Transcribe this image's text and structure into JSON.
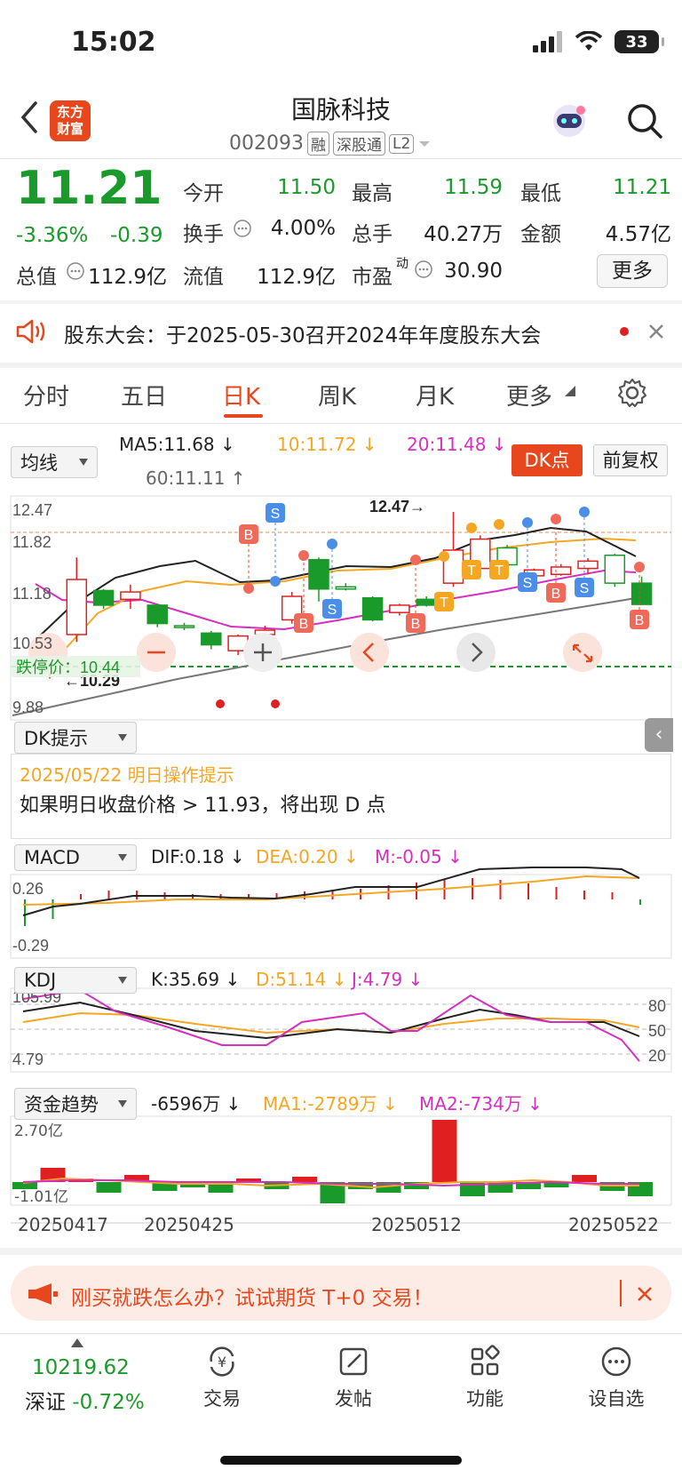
{
  "status": {
    "time": "15:02",
    "battery": "33"
  },
  "header": {
    "logo_line1": "东方",
    "logo_line2": "财富",
    "name": "国脉科技",
    "code": "002093",
    "tags": [
      "融",
      "深股通",
      "L2"
    ]
  },
  "quote": {
    "price": "11.21",
    "pct": "-3.36%",
    "change": "-0.39",
    "labels": {
      "open": "今开",
      "high": "最高",
      "low": "最低",
      "turnover": "换手",
      "volume": "总手",
      "amount": "金额",
      "mktcap": "总值",
      "float": "流值",
      "pe": "市盈",
      "pe_sup": "动"
    },
    "open": "11.50",
    "high": "11.59",
    "low": "11.21",
    "turnover": "4.00%",
    "volume": "40.27万",
    "amount": "4.57亿",
    "mktcap": "112.9亿",
    "float": "112.9亿",
    "pe": "30.90",
    "more": "更多"
  },
  "notice": {
    "text": "股东大会：于2025-05-30召开2024年年度股东大会"
  },
  "tabs": [
    "分时",
    "五日",
    "日K",
    "周K",
    "月K",
    "更多"
  ],
  "kline": {
    "selector": "均线",
    "ma5": "MA5:11.68",
    "ma10": "10:11.72",
    "ma20": "20:11.48",
    "ma60": "60:11.11",
    "dk_button": "DK点",
    "fq_button": "前复权",
    "y_labels": [
      "12.47",
      "11.82",
      "11.18",
      "10.53",
      "9.88"
    ],
    "high_marker": "12.47",
    "low_marker": "10.29",
    "limit_down": "跌停价：10.44",
    "dk_selector": "DK提示",
    "dk_date": "2025/05/22 明日操作提示",
    "dk_content": "如果明日收盘价格 > 11.93，将出现 D 点"
  },
  "macd": {
    "selector": "MACD",
    "dif": "DIF:0.18",
    "dea": "DEA:0.20",
    "m": "M:-0.05",
    "y_top": "0.26",
    "y_bottom": "-0.29"
  },
  "kdj": {
    "selector": "KDJ",
    "k": "K:35.69",
    "d": "D:51.14",
    "j": "J:4.79",
    "y_top": "105.99",
    "y_bottom": "4.79",
    "levels": [
      "80",
      "50",
      "20"
    ]
  },
  "fund": {
    "selector": "资金趋势",
    "value": "-6596万",
    "ma1": "MA1:-2789万",
    "ma2": "MA2:-734万",
    "y_top": "2.70亿",
    "y_bottom": "-1.01亿"
  },
  "dates": [
    "20250417",
    "20250425",
    "20250512",
    "20250522"
  ],
  "ad": {
    "text": "刚买就跌怎么办？试试期货 T+0 交易！"
  },
  "bottom": {
    "index_value": "10219.62",
    "index_name": "深证",
    "index_change": "-0.72%",
    "nav": [
      "交易",
      "发帖",
      "功能",
      "设自选"
    ]
  },
  "chart_data": {
    "type": "candlestick",
    "y_range": [
      9.88,
      12.47
    ],
    "candles": [
      {
        "o": 10.3,
        "c": 10.75,
        "h": 10.8,
        "l": 10.2
      },
      {
        "o": 10.8,
        "c": 11.55,
        "h": 11.85,
        "l": 10.7
      },
      {
        "o": 11.4,
        "c": 11.2,
        "h": 11.42,
        "l": 11.15
      },
      {
        "o": 11.28,
        "c": 11.38,
        "h": 11.48,
        "l": 11.15
      },
      {
        "o": 11.2,
        "c": 10.95,
        "h": 11.22,
        "l": 10.9
      },
      {
        "o": 10.92,
        "c": 10.9,
        "h": 10.96,
        "l": 10.86
      },
      {
        "o": 10.82,
        "c": 10.66,
        "h": 10.85,
        "l": 10.6
      },
      {
        "o": 10.58,
        "c": 10.78,
        "h": 10.8,
        "l": 10.52
      },
      {
        "o": 10.8,
        "c": 10.86,
        "h": 10.92,
        "l": 10.7
      },
      {
        "o": 11.0,
        "c": 11.32,
        "h": 11.38,
        "l": 10.95
      },
      {
        "o": 11.82,
        "c": 11.42,
        "h": 11.85,
        "l": 11.25
      },
      {
        "o": 11.45,
        "c": 11.42,
        "h": 11.5,
        "l": 11.4
      },
      {
        "o": 11.3,
        "c": 11.0,
        "h": 11.32,
        "l": 10.98
      },
      {
        "o": 11.1,
        "c": 11.2,
        "h": 11.22,
        "l": 11.06
      },
      {
        "o": 11.28,
        "c": 11.2,
        "h": 11.32,
        "l": 11.18
      },
      {
        "o": 11.5,
        "c": 11.95,
        "h": 12.47,
        "l": 11.45
      },
      {
        "o": 11.7,
        "c": 12.1,
        "h": 12.15,
        "l": 11.65
      },
      {
        "o": 11.98,
        "c": 11.75,
        "h": 12.02,
        "l": 11.7
      },
      {
        "o": 11.6,
        "c": 11.68,
        "h": 11.7,
        "l": 11.55
      },
      {
        "o": 11.62,
        "c": 11.72,
        "h": 11.76,
        "l": 11.6
      },
      {
        "o": 11.7,
        "c": 11.8,
        "h": 11.84,
        "l": 11.62
      },
      {
        "o": 11.88,
        "c": 11.5,
        "h": 11.9,
        "l": 11.45
      },
      {
        "o": 11.5,
        "c": 11.21,
        "h": 11.59,
        "l": 11.21
      }
    ]
  }
}
